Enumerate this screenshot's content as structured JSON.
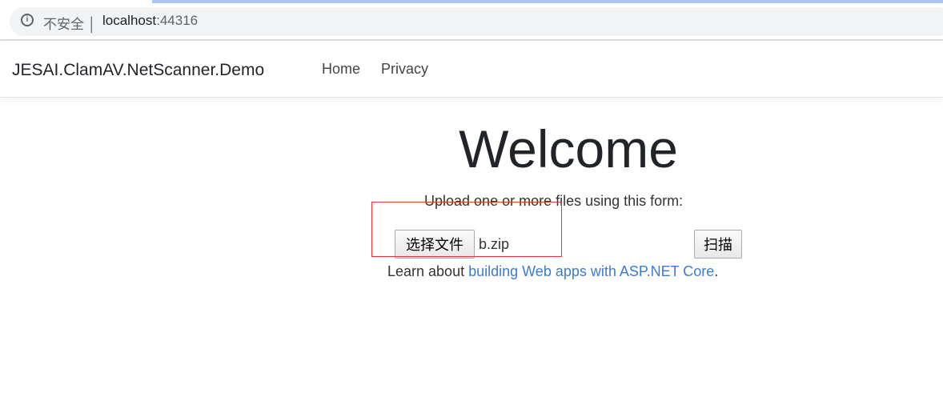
{
  "browser": {
    "security_label": "不安全",
    "host": "localhost",
    "port": ":44316"
  },
  "navbar": {
    "brand": "JESAI.ClamAV.NetScanner.Demo",
    "links": [
      "Home",
      "Privacy"
    ]
  },
  "main": {
    "title": "Welcome",
    "form_prompt": "Upload one or more files using this form:",
    "choose_file_label": "选择文件",
    "selected_file": "b.zip",
    "scan_label": "扫描",
    "learn_prefix": "Learn about ",
    "learn_link": "building Web apps with ASP.NET Core",
    "learn_suffix": "."
  }
}
